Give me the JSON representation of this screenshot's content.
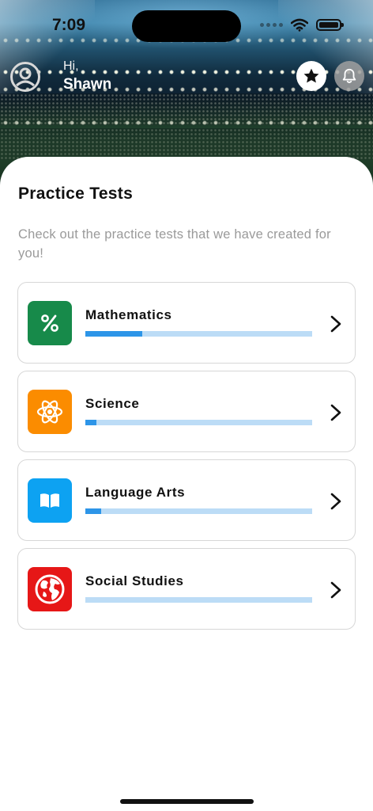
{
  "status_bar": {
    "time": "7:09",
    "icons": [
      "cellular-dots-icon",
      "wifi-icon",
      "battery-icon"
    ]
  },
  "header": {
    "greeting": "Hi,",
    "user_name": "Shawn",
    "icons": [
      "user-avatar-icon",
      "star-icon",
      "bell-icon"
    ]
  },
  "main": {
    "title": "Practice Tests",
    "subtitle": "Check out the practice tests that we have created for you!",
    "tests": [
      {
        "name": "Mathematics",
        "icon": "percent-icon",
        "color": "#178a4a",
        "progress": 0.25
      },
      {
        "name": "Science",
        "icon": "atom-icon",
        "color": "#fb8c00",
        "progress": 0.05
      },
      {
        "name": "Language Arts",
        "icon": "book-icon",
        "color": "#0da2f2",
        "progress": 0.07
      },
      {
        "name": "Social Studies",
        "icon": "globe-icon",
        "color": "#e61717",
        "progress": 0.0
      }
    ]
  },
  "colors": {
    "progress_fill": "#2d95e8",
    "progress_track": "#bcdcf6"
  }
}
